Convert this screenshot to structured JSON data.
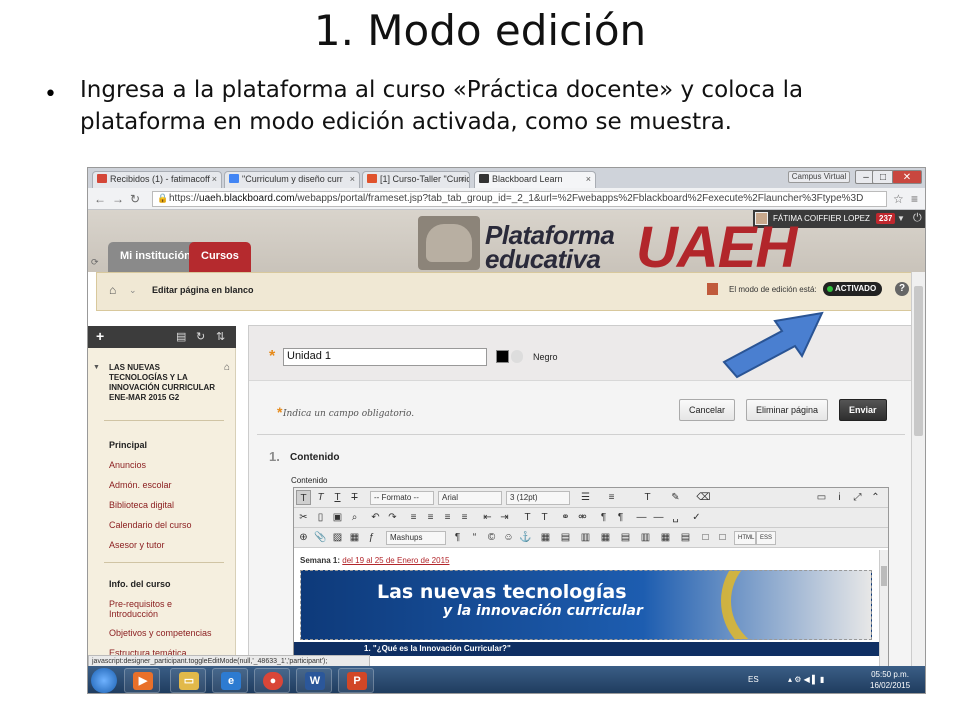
{
  "slide": {
    "title": "1. Modo edición",
    "bullet": "Ingresa a la plataforma al curso «Práctica docente» y coloca la plataforma en modo edición activada, como se muestra."
  },
  "browser": {
    "tabs": [
      {
        "label": "Recibidos (1) - fatimacoff",
        "icon_color": "#d44638"
      },
      {
        "label": "\"Curriculum y diseño curr",
        "icon_color": "#4285f4"
      },
      {
        "label": "[1] Curso-Taller \"Curricul",
        "icon_color": "#e0522c"
      },
      {
        "label": "Blackboard Learn",
        "icon_color": "#333333"
      }
    ],
    "campus_label": "Campus Virtual",
    "url_prefix": "https://",
    "url_host": "uaeh.blackboard.com",
    "url_rest": "/webapps/portal/frameset.jsp?tab_tab_group_id=_2_1&url=%2Fwebapps%2Fblackboard%2Fexecute%2Flauncher%3Ftype%3D"
  },
  "header": {
    "user_name": "FÁTIMA COIFFIER LOPEZ",
    "notifications": "237",
    "logo_line1": "Plataforma",
    "logo_line2": "educativa",
    "logo_brand": "UAEH",
    "tab_institution": "Mi institución",
    "tab_courses": "Cursos",
    "brand_color": "#b2262b"
  },
  "breadcrumb": {
    "page": "Editar página en blanco",
    "edit_mode_label": "El modo de edición está:",
    "edit_mode_state": "ACTIVADO"
  },
  "menu": {
    "course_name": "LAS NUEVAS TECNOLOGÍAS Y LA INNOVACIÓN CURRICULAR ENE-MAR 2015 G2",
    "group1_heading": "Principal",
    "group1_items": [
      "Anuncios",
      "Admón. escolar",
      "Biblioteca digital",
      "Calendario del curso",
      "Asesor y tutor"
    ],
    "group2_heading": "Info. del curso",
    "group2_items": [
      "Pre-requisitos e Introducción",
      "Objetivos y competencias",
      "Estructura temática"
    ]
  },
  "form": {
    "title_value": "Unidad 1",
    "color_name": "Negro",
    "required_note": "Indica un campo obligatorio.",
    "cancel_label": "Cancelar",
    "delete_label": "Eliminar página",
    "submit_label": "Enviar",
    "section_number": "1.",
    "section_title": "Contenido",
    "content_label": "Contenido"
  },
  "editor": {
    "format_dd": "-- Formato --",
    "font_dd": "Arial",
    "size_dd": "3 (12pt)",
    "mashups_label": "Mashups",
    "html_label": "HTML",
    "css_label": "ESS",
    "week_prefix": "Semana 1:",
    "week_link": "del 19 al 25 de Enero de 2015",
    "banner_line1": "Las nuevas tecnologías",
    "banner_line2": "y la innovación curricular",
    "question": "1. \"¿Qué es la Innovación Curricular?\""
  },
  "status": {
    "url": "javascript:designer_participant.toggleEditMode(null,'_48633_1','participant');"
  },
  "taskbar": {
    "lang": "ES",
    "time": "05:50 p.m.",
    "date": "16/02/2015"
  }
}
